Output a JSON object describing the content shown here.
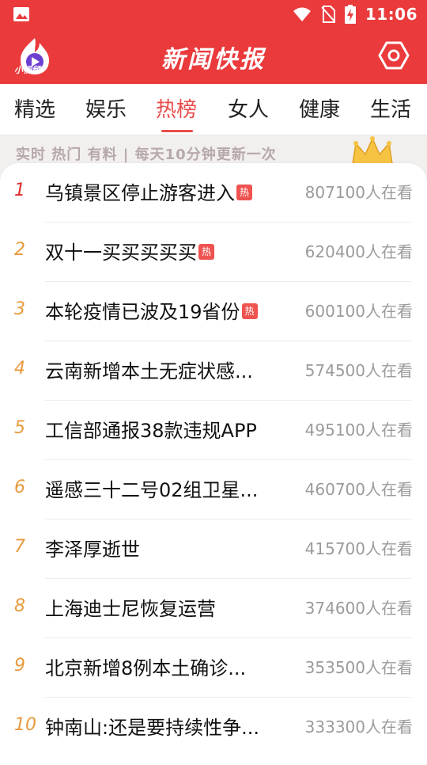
{
  "status": {
    "time": "11:06"
  },
  "app": {
    "title": "新闻快报",
    "logo_text": "小视频"
  },
  "tabs": [
    {
      "label": "精选"
    },
    {
      "label": "娱乐"
    },
    {
      "label": "热榜",
      "active": true
    },
    {
      "label": "女人"
    },
    {
      "label": "健康"
    },
    {
      "label": "生活"
    }
  ],
  "banner": {
    "text": "实时 热门 有料 | 每天10分钟更新一次"
  },
  "hot_badge": "热",
  "list": [
    {
      "rank": "1",
      "title": "乌镇景区停止游客进入",
      "hot": true,
      "views": "807100人在看"
    },
    {
      "rank": "2",
      "title": "双十一买买买买买",
      "hot": true,
      "views": "620400人在看"
    },
    {
      "rank": "3",
      "title": "本轮疫情已波及19省份",
      "hot": true,
      "views": "600100人在看"
    },
    {
      "rank": "4",
      "title": "云南新增本土无症状感...",
      "hot": false,
      "views": "574500人在看"
    },
    {
      "rank": "5",
      "title": "工信部通报38款违规APP",
      "hot": false,
      "views": "495100人在看"
    },
    {
      "rank": "6",
      "title": "遥感三十二号02组卫星...",
      "hot": false,
      "views": "460700人在看"
    },
    {
      "rank": "7",
      "title": "李泽厚逝世",
      "hot": false,
      "views": "415700人在看"
    },
    {
      "rank": "8",
      "title": "上海迪士尼恢复运营",
      "hot": false,
      "views": "374600人在看"
    },
    {
      "rank": "9",
      "title": "北京新增8例本土确诊...",
      "hot": false,
      "views": "353500人在看"
    },
    {
      "rank": "10",
      "title": "钟南山:还是要持续性争...",
      "hot": false,
      "views": "333300人在看"
    }
  ],
  "colors": {
    "header": "#ea3a3c",
    "accent": "#e94b4b",
    "rank_top": "#e02a2a",
    "rank_other": "#e79a3d"
  }
}
